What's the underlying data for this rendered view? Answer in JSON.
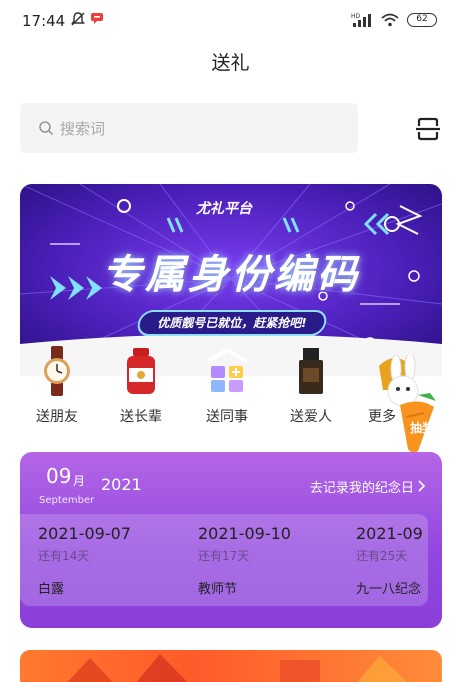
{
  "status_bar": {
    "time": "17:44",
    "battery": "62",
    "network": "HD"
  },
  "page": {
    "title": "送礼"
  },
  "search": {
    "placeholder": "搜索词"
  },
  "banner": {
    "badge": "尤礼平台",
    "headline": "专属身份编码",
    "pill": "优质靓号已就位，赶紧抢吧!"
  },
  "categories": [
    {
      "label": "送朋友",
      "icon": "watch-icon"
    },
    {
      "label": "送长辈",
      "icon": "supplement-jar-icon"
    },
    {
      "label": "送同事",
      "icon": "blocks-icon"
    },
    {
      "label": "送爱人",
      "icon": "perfume-icon"
    },
    {
      "label": "更多",
      "icon": "more-gift-icon"
    }
  ],
  "lottery": {
    "label": "抽奖"
  },
  "anniversary": {
    "month": "09",
    "month_suffix": "月",
    "month_en": "September",
    "year": "2021",
    "link": "去记录我的纪念日",
    "days": [
      {
        "date": "2021-09-07",
        "remaining": "还有14天",
        "name": "白露"
      },
      {
        "date": "2021-09-10",
        "remaining": "还有17天",
        "name": "教师节"
      },
      {
        "date": "2021-09",
        "remaining": "还有25天",
        "name": "九一八纪念"
      }
    ]
  },
  "colors": {
    "card_purple": "#9248df",
    "banner_purple": "#4a1fb8",
    "accent_orange": "#ff6a2a"
  }
}
